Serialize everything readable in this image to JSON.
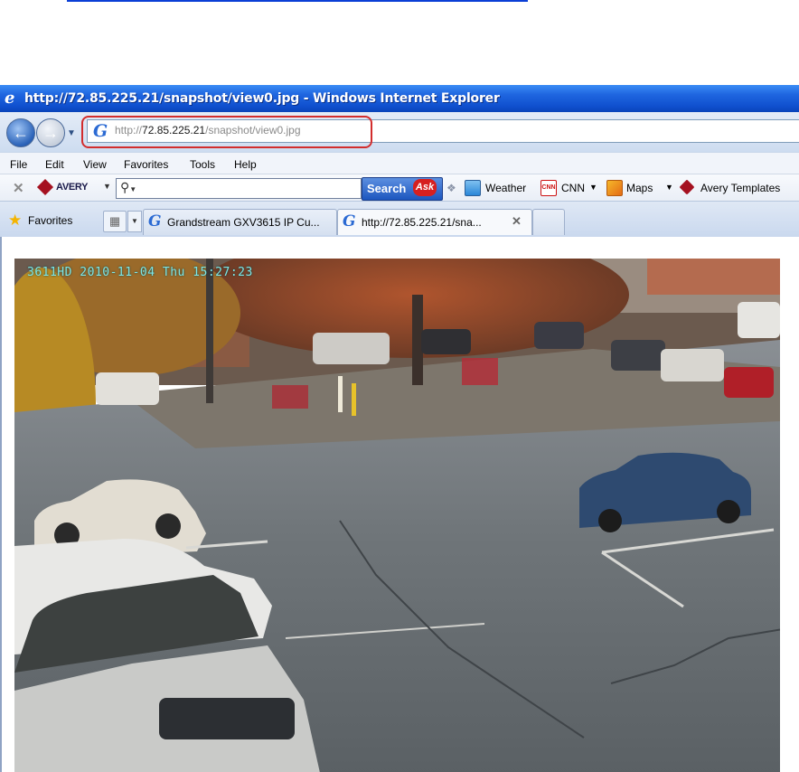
{
  "window": {
    "title": "http://72.85.225.21/snapshot/view0.jpg - Windows Internet Explorer"
  },
  "address_bar": {
    "scheme": "http://",
    "host": "72.85.225.21",
    "path": "/snapshot/view0.jpg"
  },
  "menu": [
    "File",
    "Edit",
    "View",
    "Favorites",
    "Tools",
    "Help"
  ],
  "toolbar": {
    "avery_label": "AVERY",
    "search_button": "Search",
    "ask_label": "Ask",
    "links": [
      {
        "label": "Weather",
        "icon": "weather-icon"
      },
      {
        "label": "CNN",
        "icon": "cnn-icon"
      },
      {
        "label": "Maps",
        "icon": "maps-icon"
      },
      {
        "label": "Avery Templates",
        "icon": "avery-templates-icon"
      }
    ],
    "cnn_icon_text": "CNN"
  },
  "tabs": {
    "favorites_label": "Favorites",
    "items": [
      {
        "label": "Grandstream GXV3615 IP Cu...",
        "active": false
      },
      {
        "label": "http://72.85.225.21/sna...",
        "active": true
      }
    ]
  },
  "snapshot": {
    "osd_text": "3611HD  2010-11-04 Thu 15:27:23",
    "description_icons": "parking-lot-camera-image"
  },
  "colors": {
    "titlebar": "#1f66e0",
    "highlight_outline": "#d22d2d",
    "osd_text": "#7fe6e6"
  }
}
